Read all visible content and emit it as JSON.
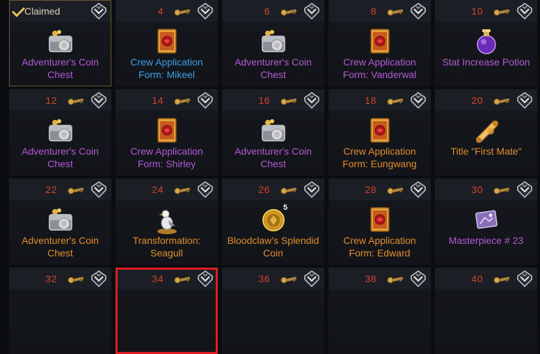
{
  "claimed_label": "Claimed",
  "colors": {
    "epic": "#b65ad6",
    "rare": "#3ea0e6",
    "legendary": "#e38d2d",
    "number": "#d7432f",
    "highlight": "#e01d24"
  },
  "rewards": [
    {
      "number": "",
      "claimed": true,
      "name": "Adventurer's Coin Chest",
      "rarity": "purple",
      "icon": "coin-chest-icon"
    },
    {
      "number": "4",
      "name": "Crew Application Form: Mikeel",
      "rarity": "blue",
      "icon": "application-form-icon"
    },
    {
      "number": "6",
      "name": "Adventurer's Coin Chest",
      "rarity": "purple",
      "icon": "coin-chest-icon"
    },
    {
      "number": "8",
      "name": "Crew Application Form: Vanderwal",
      "rarity": "purple",
      "icon": "application-form-icon"
    },
    {
      "number": "10",
      "name": "Stat Increase Potion",
      "rarity": "purple",
      "icon": "potion-icon"
    },
    {
      "number": "12",
      "name": "Adventurer's Coin Chest",
      "rarity": "purple",
      "icon": "coin-chest-icon"
    },
    {
      "number": "14",
      "name": "Crew Application Form: Shirley",
      "rarity": "purple",
      "icon": "application-form-icon"
    },
    {
      "number": "16",
      "name": "Adventurer's Coin Chest",
      "rarity": "purple",
      "icon": "coin-chest-icon"
    },
    {
      "number": "18",
      "name": "Crew Application Form: Eungwang",
      "rarity": "orange",
      "icon": "application-form-icon"
    },
    {
      "number": "20",
      "name": "Title \"First Mate\"",
      "rarity": "orange",
      "icon": "title-scroll-icon"
    },
    {
      "number": "22",
      "name": "Adventurer's Coin Chest",
      "rarity": "orange",
      "icon": "coin-chest-icon"
    },
    {
      "number": "24",
      "name": "Transformation: Seagull",
      "rarity": "orange",
      "icon": "seagull-icon"
    },
    {
      "number": "26",
      "name": "Bloodclaw's Splendid Coin",
      "rarity": "orange",
      "icon": "splendid-coin-icon",
      "count": "5"
    },
    {
      "number": "28",
      "name": "Crew Application Form: Edward",
      "rarity": "orange",
      "icon": "application-form-icon"
    },
    {
      "number": "30",
      "name": "Masterpiece # 23",
      "rarity": "purple",
      "icon": "masterpiece-icon"
    },
    {
      "number": "32",
      "name": "",
      "rarity": "purple",
      "icon": ""
    },
    {
      "number": "34",
      "name": "",
      "rarity": "purple",
      "icon": "",
      "highlight": true
    },
    {
      "number": "36",
      "name": "",
      "rarity": "purple",
      "icon": ""
    },
    {
      "number": "38",
      "name": "",
      "rarity": "purple",
      "icon": ""
    },
    {
      "number": "40",
      "name": "",
      "rarity": "purple",
      "icon": ""
    }
  ]
}
